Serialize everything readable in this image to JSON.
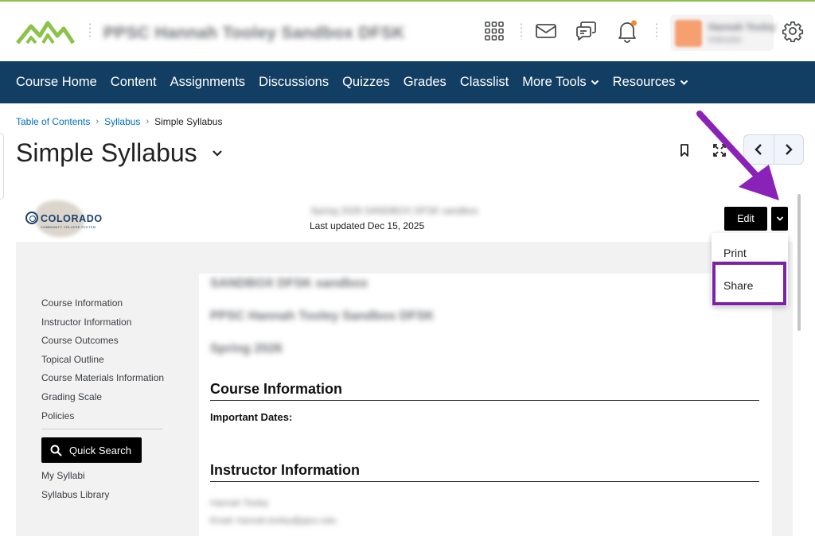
{
  "colors": {
    "nav_bg": "#123e64",
    "link": "#006fbf",
    "logo_green": "#8bc34a",
    "highlight_purple": "#7b22a8",
    "notification_dot": "#f7882f"
  },
  "minibar": {
    "course_title": "PPSC Hannah Tooley Sandbox DFSK",
    "user_name": "Hannah Tooley",
    "user_role": "Instructor",
    "icons": [
      "waffle-icon",
      "mail-icon",
      "chat-icon",
      "bell-icon",
      "gear-icon"
    ]
  },
  "nav": {
    "items": [
      {
        "label": "Course Home"
      },
      {
        "label": "Content"
      },
      {
        "label": "Assignments"
      },
      {
        "label": "Discussions"
      },
      {
        "label": "Quizzes"
      },
      {
        "label": "Grades"
      },
      {
        "label": "Classlist"
      },
      {
        "label": "More Tools"
      },
      {
        "label": "Resources"
      }
    ]
  },
  "breadcrumb": {
    "items": [
      "Table of Contents",
      "Syllabus"
    ],
    "current": "Simple Syllabus"
  },
  "page": {
    "title": "Simple Syllabus"
  },
  "syllabus": {
    "logo_text": "COLORADO",
    "logo_subtext": "COMMUNITY COLLEGE SYSTEM",
    "term_line": "Spring 2026 SANDBOX DFSK sandbox",
    "last_updated": "Last updated Dec 15, 2025",
    "edit_label": "Edit",
    "toc": [
      "Course Information",
      "Instructor Information",
      "Course Outcomes",
      "Topical Outline",
      "Course Materials Information",
      "Grading Scale",
      "Policies"
    ],
    "quick_search_label": "Quick Search",
    "links": [
      "My Syllabi",
      "Syllabus Library"
    ],
    "content": {
      "blur_lines": [
        "SANDBOX DFSK sandbox",
        "PPSC Hannah Tooley Sandbox DFSK",
        "Spring 2026"
      ],
      "course_info_heading": "Course Information",
      "important_dates": "Important Dates:",
      "instructor_heading": "Instructor Information",
      "instructor_name": "Hannah Tooley",
      "instructor_email": "Email: hannah.tooley@ppcc.edu"
    }
  },
  "menu": {
    "items": [
      "Print",
      "Share"
    ]
  }
}
